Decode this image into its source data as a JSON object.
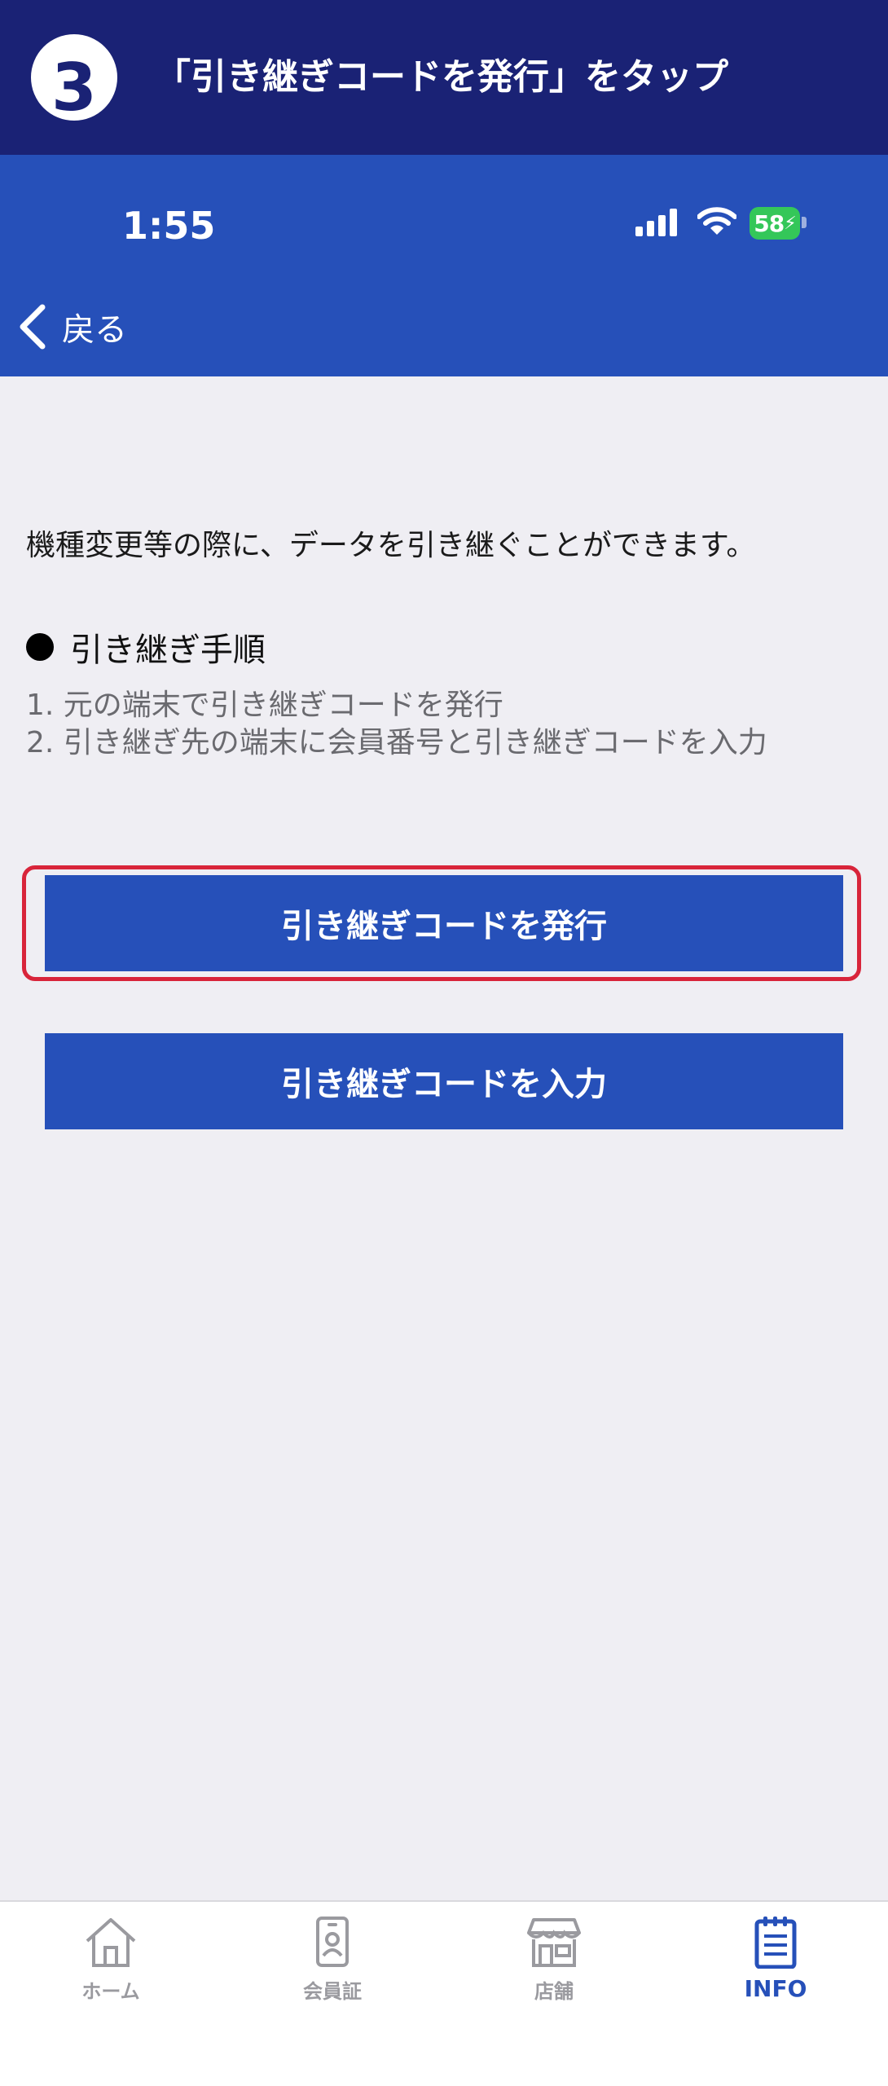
{
  "banner": {
    "step_number": "3",
    "title": "「引き継ぎコードを発行」をタップ"
  },
  "status_bar": {
    "time": "1:55",
    "battery": "58"
  },
  "nav": {
    "back_label": "戻る"
  },
  "content": {
    "intro": "機種変更等の際に、データを引き継ぐことができます。",
    "steps_heading": "引き継ぎ手順",
    "steps": [
      "1. 元の端末で引き継ぎコードを発行",
      "2. 引き継ぎ先の端末に会員番号と引き継ぎコードを入力"
    ],
    "issue_button": "引き継ぎコードを発行",
    "enter_button": "引き継ぎコードを入力"
  },
  "tabbar": {
    "items": [
      {
        "label": "ホーム",
        "icon": "home-icon"
      },
      {
        "label": "会員証",
        "icon": "member-card-icon"
      },
      {
        "label": "店舗",
        "icon": "store-icon"
      },
      {
        "label": "INFO",
        "icon": "info-notepad-icon",
        "active": true
      }
    ]
  },
  "colors": {
    "banner_bg": "#1a2275",
    "header_bg": "#2650b9",
    "button_bg": "#2650b9",
    "highlight": "#d8243a",
    "page_bg": "#efeef3"
  }
}
